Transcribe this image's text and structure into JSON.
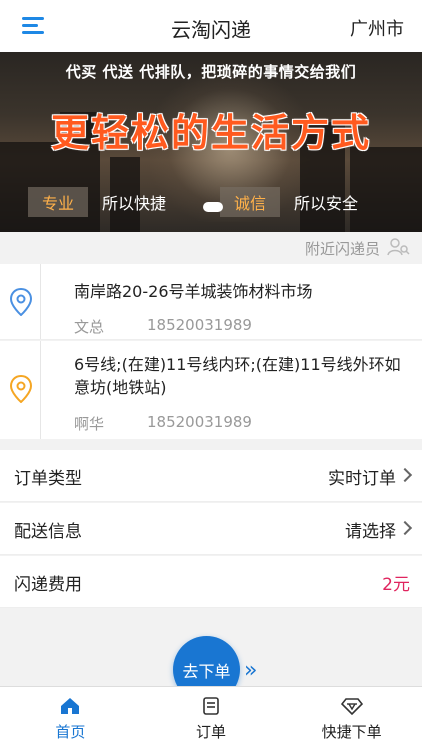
{
  "header": {
    "title": "云淘闪递",
    "city": "广州市"
  },
  "banner": {
    "slogan": "代买 代送 代排队，把琐碎的事情交给我们",
    "headline": "更轻松的生活方式",
    "tags": [
      "专业",
      "所以快捷",
      "诚信",
      "所以安全"
    ]
  },
  "nearby": {
    "label": "附近闪递员"
  },
  "addresses": [
    {
      "address": "南岸路20-26号羊城装饰材料市场",
      "name": "文总",
      "phone": "18520031989"
    },
    {
      "address": "6号线;(在建)11号线内环;(在建)11号线外环如意坊(地铁站)",
      "name": "啊华",
      "phone": "18520031989"
    }
  ],
  "options": {
    "order_type": {
      "label": "订单类型",
      "value": "实时订单"
    },
    "delivery_info": {
      "label": "配送信息",
      "value": "请选择"
    },
    "fee": {
      "label": "闪递费用",
      "value": "2元"
    }
  },
  "order_button": {
    "label": "去下单",
    "arrows": "»"
  },
  "tabs": [
    {
      "label": "首页",
      "icon": "home-icon"
    },
    {
      "label": "订单",
      "icon": "order-icon"
    },
    {
      "label": "快捷下单",
      "icon": "diamond-icon"
    }
  ],
  "colors": {
    "accent": "#1976d2",
    "price": "#e0245e",
    "headline": "#ff5a1f",
    "tag_highlight": "#ffb14a"
  }
}
